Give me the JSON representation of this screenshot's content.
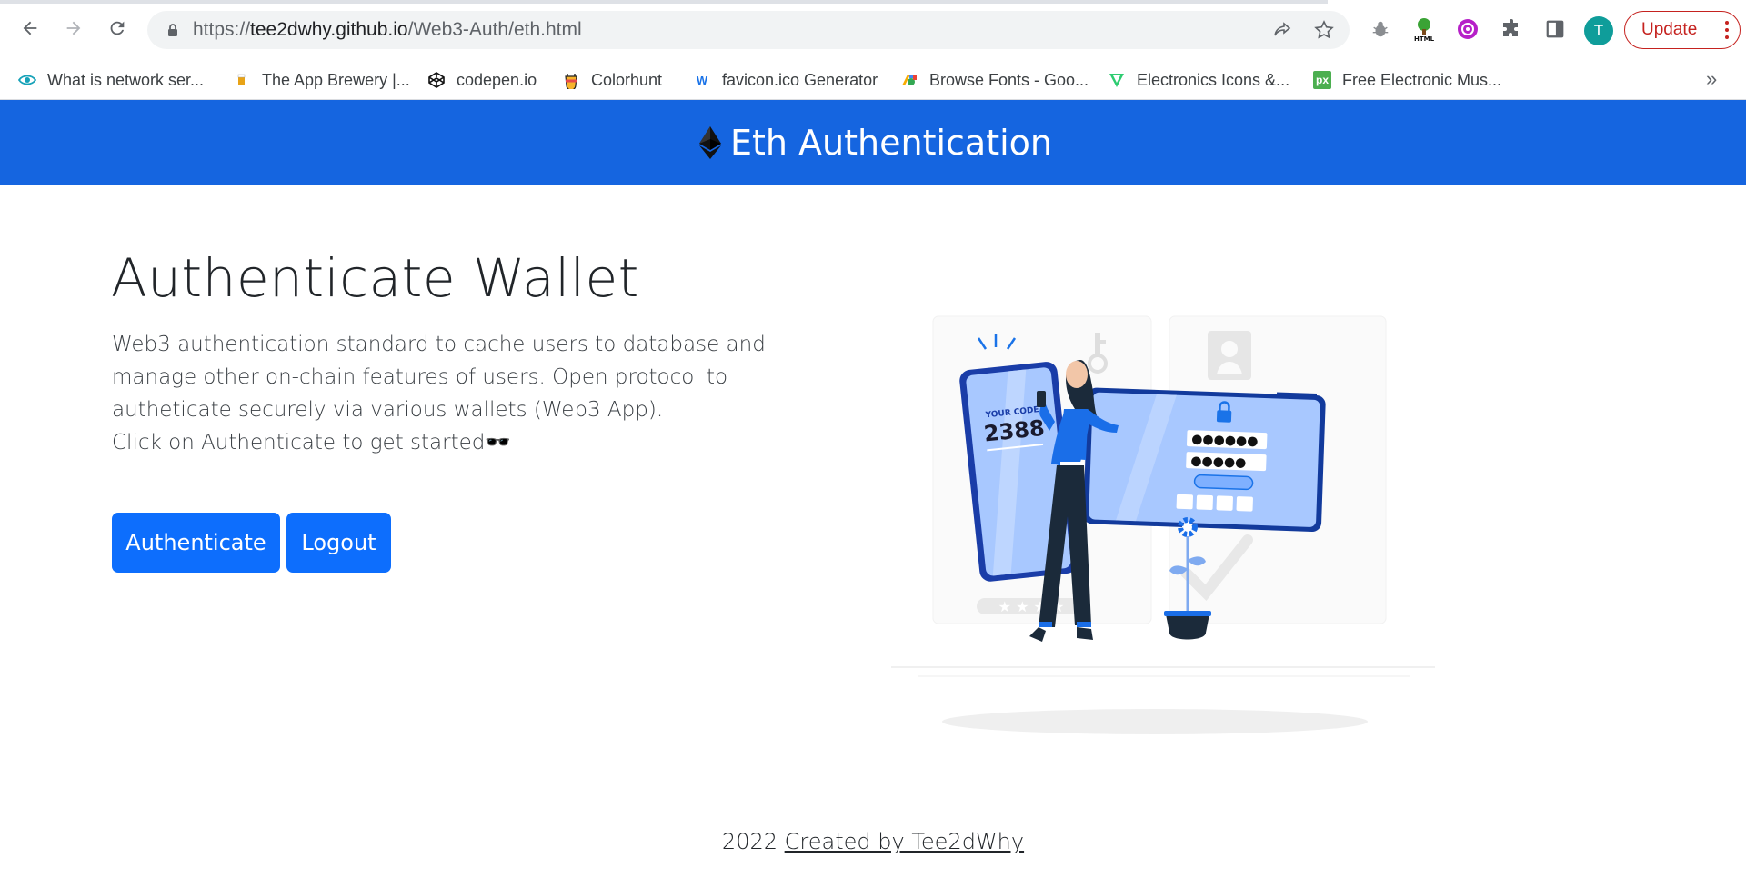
{
  "browser": {
    "url_host": "tee2dwhy.github.io",
    "url_path": "/Web3-Auth/eth.html",
    "update_label": "Update",
    "profile_initial": "T",
    "bookmarks": [
      "What is network ser...",
      "The App Brewery |...",
      "codepen.io",
      "Colorhunt",
      "favicon.ico Generator",
      "Browse Fonts - Goo...",
      "Electronics Icons &...",
      "Free Electronic Mus..."
    ],
    "more_bookmarks": "»"
  },
  "navbar": {
    "brand": "Eth Authentication",
    "color": "#1565e0"
  },
  "hero": {
    "title": "Authenticate Wallet",
    "lines": [
      "Web3 authentication standard to cache users to database and",
      "manage other on-chain features of users. Open protocol to",
      "autheticate securely via various wallets (Web3 App).",
      "Click on Authenticate to get started🕶️"
    ],
    "authenticate_label": "Authenticate",
    "logout_label": "Logout",
    "button_color": "#0d6efd"
  },
  "illustration": {
    "code_label": "YOUR CODE",
    "code_value": "2388"
  },
  "footer": {
    "year": "2022",
    "link_text": "Created by Tee2dWhy"
  }
}
